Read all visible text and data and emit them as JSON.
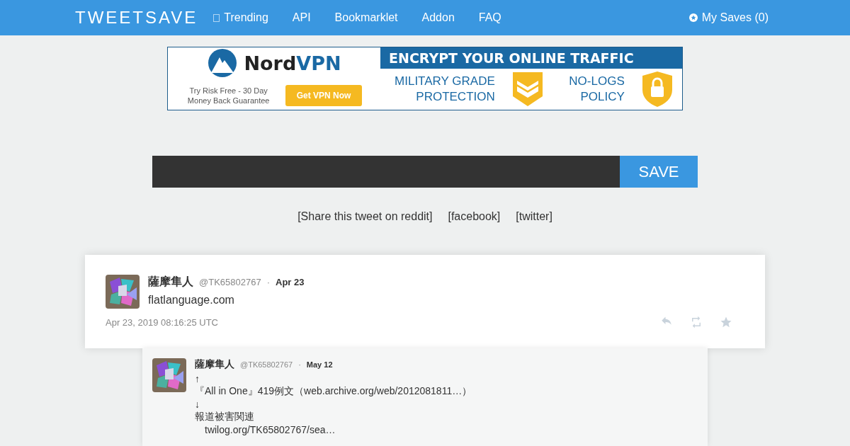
{
  "nav": {
    "logo": "TWEETSAVE",
    "links": [
      {
        "label": "Trending",
        "icon": true
      },
      {
        "label": "API",
        "icon": false
      },
      {
        "label": "Bookmarklet",
        "icon": false
      },
      {
        "label": "Addon",
        "icon": false
      },
      {
        "label": "FAQ",
        "icon": false
      }
    ],
    "my_saves": "My Saves (0)"
  },
  "ad": {
    "brand_a": "Nord",
    "brand_b": "VPN",
    "offer": "Try Risk Free - 30 Day Money Back Guarantee",
    "cta": "Get VPN Now",
    "headline": "ENCRYPT YOUR ONLINE TRAFFIC",
    "feature_1": "MILITARY GRADE PROTECTION",
    "feature_2": "NO-LOGS POLICY"
  },
  "save_form": {
    "button": "SAVE"
  },
  "share_links": [
    "[Share this tweet on reddit]",
    "[facebook]",
    "[twitter]"
  ],
  "tweet": {
    "name": "薩摩隼人",
    "handle": "@TK65802767",
    "sep": "·",
    "date": "Apr 23",
    "text": "flatlanguage.com",
    "timestamp": "Apr 23, 2019 08:16:25 UTC"
  },
  "reply": {
    "name": "薩摩隼人",
    "handle": "@TK65802767",
    "sep": "·",
    "date": "May 12",
    "lines": [
      "↑",
      "『All in One』419例文（web.archive.org/web/2012081811…）",
      "↓",
      "報道被害関連",
      "　twilog.org/TK65802767/sea…"
    ]
  }
}
